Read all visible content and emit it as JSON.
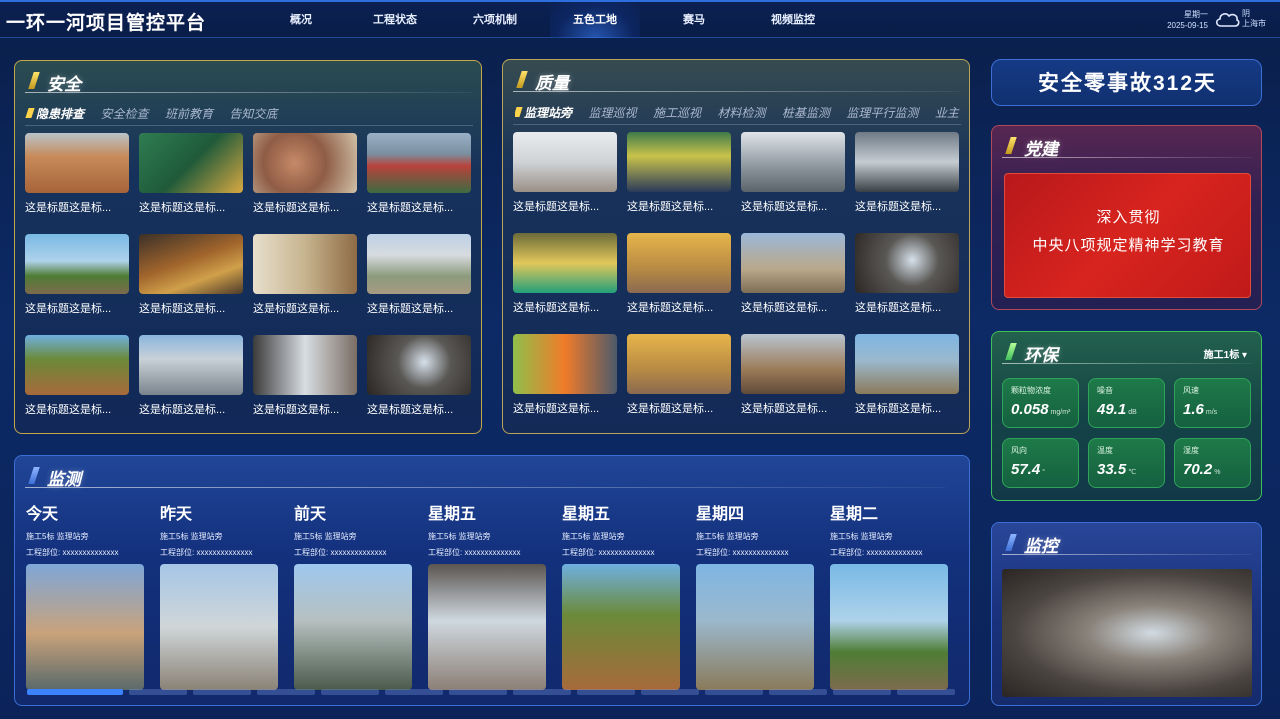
{
  "app": {
    "title": "一环一河项目管控平台",
    "nav": [
      {
        "label": "概况"
      },
      {
        "label": "工程状态"
      },
      {
        "label": "六项机制"
      },
      {
        "label": "五色工地"
      },
      {
        "label": "赛马"
      },
      {
        "label": "视频监控"
      }
    ],
    "active_nav": "五色工地",
    "weekday": "星期一",
    "date": "2025-09-15",
    "weather": "阴",
    "city": "上海市"
  },
  "safety": {
    "title": "安全",
    "tabs": [
      "隐患排查",
      "安全检查",
      "班前教育",
      "告知交底"
    ],
    "caption": "这是标题这是标..."
  },
  "quality": {
    "title": "质量",
    "tabs": [
      "监理站旁",
      "监理巡视",
      "施工巡视",
      "材料检测",
      "桩基监测",
      "监理平行监测",
      "业主"
    ],
    "caption": "这是标题这是标..."
  },
  "monitor": {
    "title": "监测",
    "days": [
      {
        "title": "今天",
        "sub": "施工5标   监理站旁",
        "part": "工程部位: xxxxxxxxxxxxxx"
      },
      {
        "title": "昨天",
        "sub": "施工5标   监理站旁",
        "part": "工程部位: xxxxxxxxxxxxxx"
      },
      {
        "title": "前天",
        "sub": "施工5标   监理站旁",
        "part": "工程部位: xxxxxxxxxxxxxx"
      },
      {
        "title": "星期五",
        "sub": "施工5标   监理站旁",
        "part": "工程部位: xxxxxxxxxxxxxx"
      },
      {
        "title": "星期五",
        "sub": "施工5标   监理站旁",
        "part": "工程部位: xxxxxxxxxxxxxx"
      },
      {
        "title": "星期四",
        "sub": "施工5标   监理站旁",
        "part": "工程部位: xxxxxxxxxxxxxx"
      },
      {
        "title": "星期二",
        "sub": "施工5标   监理站旁",
        "part": "工程部位: xxxxxxxxxxxxxx"
      }
    ]
  },
  "zero_accident": "安全零事故312天",
  "party": {
    "title": "党建",
    "line1": "深入贯彻",
    "line2": "中央八项规定精神学习教育"
  },
  "env": {
    "title": "环保",
    "selector": "施工1标 ▾",
    "cards": [
      {
        "label": "颗粒物浓度",
        "value": "0.058",
        "unit": "mg/m³"
      },
      {
        "label": "噪音",
        "value": "49.1",
        "unit": "dB"
      },
      {
        "label": "风速",
        "value": "1.6",
        "unit": "m/s"
      },
      {
        "label": "风向",
        "value": "57.4",
        "unit": "°"
      },
      {
        "label": "温度",
        "value": "33.5",
        "unit": "℃"
      },
      {
        "label": "湿度",
        "value": "70.2",
        "unit": "%"
      }
    ]
  },
  "cctv": {
    "title": "监控"
  },
  "icons": {
    "weather": "cloud-icon",
    "panel_mark": "title-marker-icon"
  },
  "colors": {
    "accent": "#3d82ff",
    "party_red": "#d8241e",
    "env_green": "#1e7a48",
    "marker_gold": "#ffd34a"
  }
}
